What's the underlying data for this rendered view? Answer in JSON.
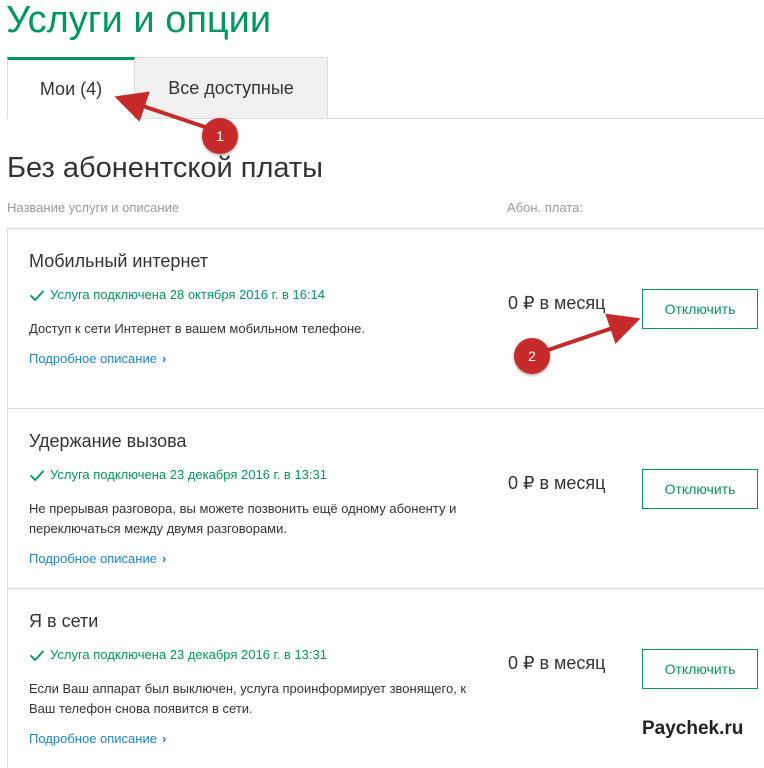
{
  "page": {
    "title": "Услуги и опции"
  },
  "tabs": [
    {
      "label": "Мои (4)",
      "active": true
    },
    {
      "label": "Все доступные",
      "active": false
    }
  ],
  "section": {
    "title": "Без абонентской платы",
    "col_name": "Название услуги и описание",
    "col_fee": "Абон. плата:"
  },
  "services": [
    {
      "name": "Мобильный интернет",
      "status": "Услуга подключена 28 октября 2016 г. в 16:14",
      "desc_lines": [
        "Доступ к сети Интернет в вашем мобильном телефоне."
      ],
      "more": "Подробное описание",
      "price": "0 ₽ в месяц",
      "button": "Отключить"
    },
    {
      "name": "Удержание вызова",
      "status": "Услуга подключена 23 декабря 2016 г. в 13:31",
      "desc_lines": [
        "Не прерывая разговора, вы можете позвонить ещё одному абоненту и",
        "переключаться между двумя разговорами."
      ],
      "more": "Подробное описание",
      "price": "0 ₽ в месяц",
      "button": "Отключить"
    },
    {
      "name": "Я в сети",
      "status": "Услуга подключена 23 декабря 2016 г. в 13:31",
      "desc_lines": [
        "Если Ваш аппарат был выключен, услуга проинформирует звонящего, к",
        "Ваш телефон снова появится в сети."
      ],
      "more": "Подробное описание",
      "price": "0 ₽ в месяц",
      "button": "Отключить"
    }
  ],
  "annotations": [
    {
      "number": "1"
    },
    {
      "number": "2"
    }
  ],
  "watermark": "Paychek.ru",
  "colors": {
    "accent": "#00985f",
    "link": "#1a85c8",
    "annotation": "#c62a2a"
  }
}
